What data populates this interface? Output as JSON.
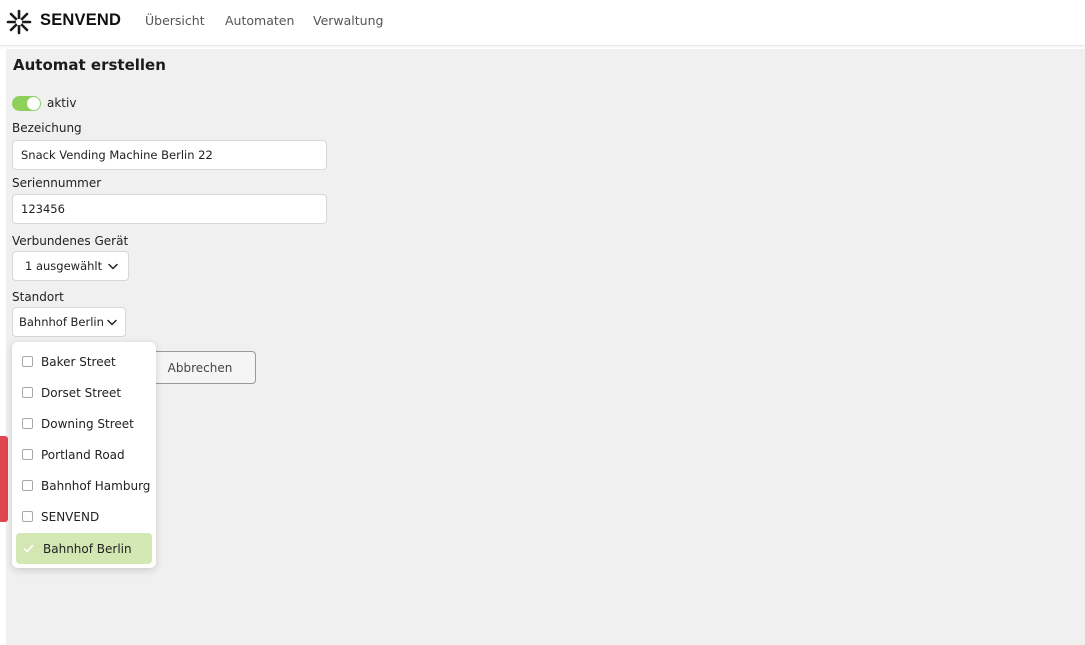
{
  "nav": {
    "logo_icon": "asterisk-logo-icon",
    "logo_text": "SENVEND",
    "links": [
      "Übersicht",
      "Automaten",
      "Verwaltung"
    ]
  },
  "form": {
    "title": "Automat erstellen",
    "active": {
      "label": "aktiv",
      "checked": true
    },
    "name": {
      "label": "Bezeichung",
      "value": "Snack Vending Machine Berlin 22"
    },
    "serial": {
      "label": "Seriennummer",
      "value": "123456"
    },
    "device": {
      "label": "Verbundenes Gerät",
      "value": "1 ausgewählt",
      "icon": "chevron-down-icon"
    },
    "location": {
      "label": "Standort",
      "value": "Bahnhof Berlin",
      "icon": "chevron-down-icon"
    },
    "cancel_label": "Abbrechen"
  },
  "location_dropdown": {
    "options": [
      {
        "label": "Baker Street",
        "checked": false
      },
      {
        "label": "Dorset Street",
        "checked": false
      },
      {
        "label": "Downing Street",
        "checked": false
      },
      {
        "label": "Portland Road",
        "checked": false
      },
      {
        "label": "Bahnhof Hamburg",
        "checked": false
      },
      {
        "label": "SENVEND",
        "checked": false
      },
      {
        "label": "Bahnhof Berlin",
        "checked": true
      }
    ]
  },
  "colors": {
    "toggle_on": "#8fd05b",
    "selected_option_bg": "#d3e7b3",
    "feedback_tab": "#e0464f",
    "panel_bg": "#f0f0f0"
  }
}
